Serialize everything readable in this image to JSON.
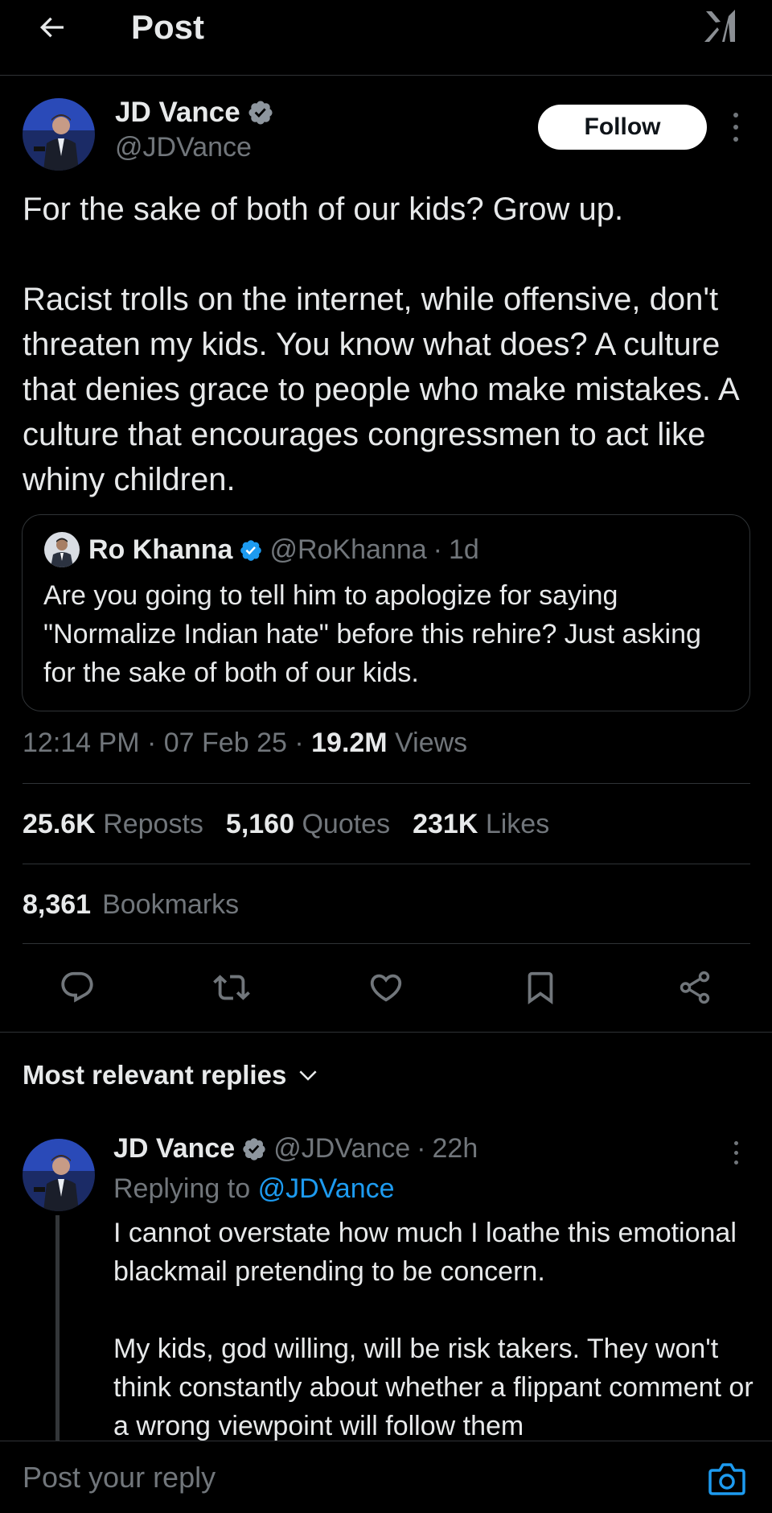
{
  "header": {
    "title": "Post"
  },
  "post": {
    "author_name": "JD Vance",
    "author_handle": "@JDVance",
    "follow_label": "Follow",
    "text": "For the sake of both of our kids? Grow up.\n\nRacist trolls on the internet, while offensive, don't threaten my kids. You know what does? A culture that denies grace to people who make mistakes. A culture that encourages congressmen to act like whiny children.",
    "quote": {
      "author_name": "Ro Khanna",
      "author_handle": "@RoKhanna",
      "separator": "·",
      "time": "1d",
      "text": "Are you going to tell him to apologize for saying \"Normalize Indian hate\" before this rehire? Just asking for the sake of both of our kids."
    },
    "time": "12:14 PM",
    "separator": "·",
    "date": "07 Feb 25",
    "views_count": "19.2M",
    "views_label": "Views",
    "reposts_count": "25.6K",
    "reposts_label": "Reposts",
    "quotes_count": "5,160",
    "quotes_label": "Quotes",
    "likes_count": "231K",
    "likes_label": "Likes",
    "bookmarks_count": "8,361",
    "bookmarks_label": "Bookmarks"
  },
  "actions": [
    "reply-icon",
    "repost-icon",
    "like-icon",
    "bookmark-icon",
    "share-icon"
  ],
  "replies": {
    "filter_label": "Most relevant replies",
    "items": [
      {
        "author_name": "JD Vance",
        "author_handle": "@JDVance",
        "separator": "·",
        "time": "22h",
        "replying_prefix": "Replying to",
        "replying_handle": "@JDVance",
        "text": "I cannot overstate how much I loathe this emotional blackmail pretending to be concern.\n\nMy kids, god willing, will be risk takers. They won't think constantly about whether a flippant comment or a wrong viewpoint will follow them"
      }
    ]
  },
  "composer": {
    "placeholder": "Post your reply"
  },
  "colors": {
    "background": "#000000",
    "text": "#e7e9ea",
    "muted": "#71767b",
    "accent": "#1d9bf0",
    "border": "#2f3336"
  }
}
